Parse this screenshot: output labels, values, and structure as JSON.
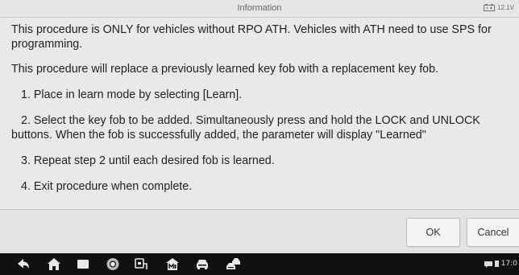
{
  "window": {
    "title": "Information",
    "battery_voltage": "12.1V"
  },
  "message": {
    "intro": "This procedure is ONLY for vehicles without RPO ATH. Vehicles with ATH need to use SPS for programming.",
    "purpose": "This procedure will replace a previously learned key fob with a replacement key fob.",
    "steps": [
      "1. Place in learn mode by selecting [Learn].",
      "2. Select the key fob to be added. Simultaneously press and hold the LOCK and UNLOCK buttons. When the fob is successfully added, the parameter will display \"Learned\"",
      "3. Repeat step 2 until each desired fob is learned.",
      "4. Exit procedure when complete."
    ]
  },
  "buttons": {
    "ok": "OK",
    "cancel": "Cancel"
  },
  "navbar": {
    "icons": [
      "back-icon",
      "home-icon",
      "recent-apps-icon",
      "chrome-browser-icon",
      "vci-connect-icon",
      "maxifix-icon",
      "vehicle-icon",
      "car-service-icon"
    ],
    "clock": "17:0"
  }
}
